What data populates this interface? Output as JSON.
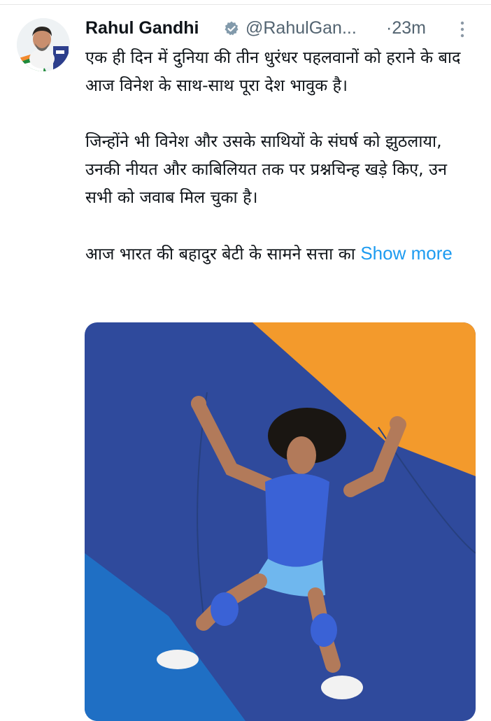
{
  "tweet": {
    "author_name": "Rahul Gandhi",
    "handle": "@RahulGan...",
    "time": "·23m",
    "paragraphs": [
      "एक ही दिन में दुनिया की तीन धुरंधर पहलवानों को हराने के बाद आज विनेश के साथ-साथ पूरा देश भावुक है।",
      "जिन्होंने भी विनेश और उसके साथियों के संघर्ष को झुठलाया, उनकी नीयत और काबिलियत तक पर प्रश्नचिन्ह खड़े किए, उन सभी को जवाब मिल चुका है।",
      "आज भारत की बहादुर बेटी के सामने सत्ता का"
    ],
    "show_more": "Show more"
  },
  "icons": {
    "verified": "verified-badge-icon",
    "more": "more-vertical-icon"
  },
  "colors": {
    "link": "#1d9bf0",
    "secondary_text": "#536471",
    "mat_blue": "#2f4a9c",
    "mat_orange": "#f39a2c"
  }
}
